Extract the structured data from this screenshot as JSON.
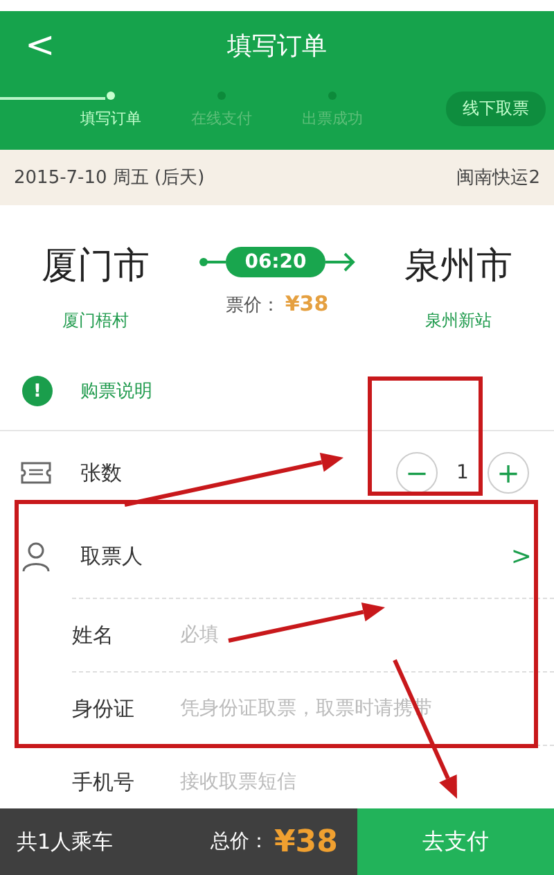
{
  "header": {
    "title": "填写订单",
    "back": "<"
  },
  "steps": [
    {
      "label": "填写订单",
      "selected": true
    },
    {
      "label": "在线支付",
      "selected": false
    },
    {
      "label": "出票成功",
      "selected": false
    }
  ],
  "offline_button": "线下取票",
  "trip": {
    "date": "2015-7-10 周五 (后天)",
    "bus": "闽南快运2",
    "from_city": "厦门市",
    "from_station": "厦门梧村",
    "time": "06:20",
    "price_label": "票价：",
    "price": "¥38",
    "to_city": "泉州市",
    "to_station": "泉州新站"
  },
  "notice": {
    "icon": "!",
    "label": "购票说明"
  },
  "count": {
    "label": "张数",
    "minus": "−",
    "value": "1",
    "plus": "+"
  },
  "passenger": {
    "label": "取票人",
    "chevron": ">"
  },
  "fields": [
    {
      "label": "姓名",
      "placeholder": "必填"
    },
    {
      "label": "身份证",
      "placeholder": "凭身份证取票，取票时请携带"
    },
    {
      "label": "手机号",
      "placeholder": "接收取票短信"
    }
  ],
  "bottom_bar": {
    "riders": "共1人乘车",
    "total_label": "总价：",
    "total": "¥38",
    "pay_button": "去支付"
  }
}
